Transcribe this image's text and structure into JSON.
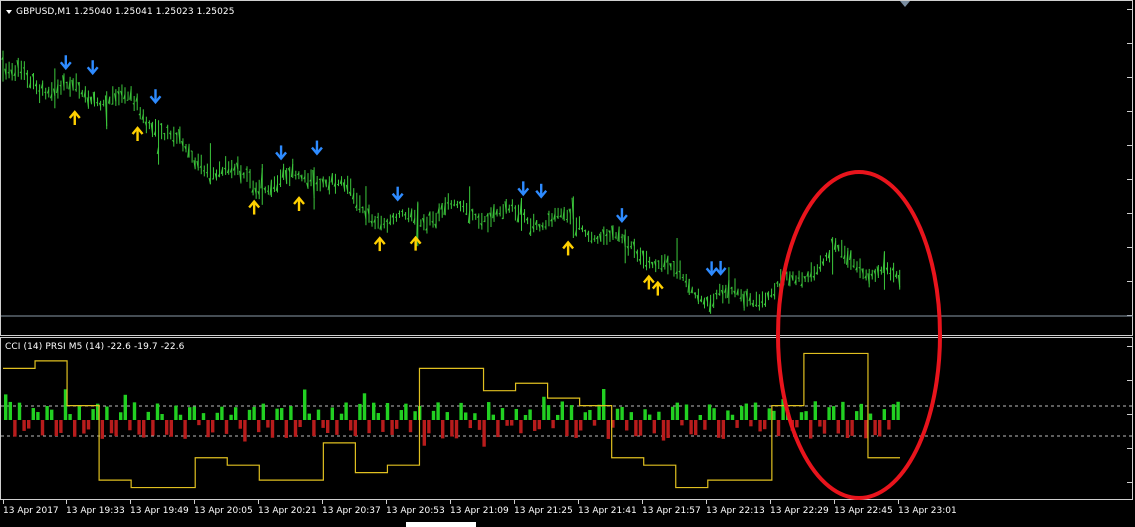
{
  "chart_window": {
    "price_pane_label": "GBPUSD,M1  1.25040 1.25041 1.25023 1.25025",
    "symbol": "GBPUSD",
    "timeframe": "M1",
    "ohlc": {
      "open": "1.25040",
      "high": "1.25041",
      "low": "1.25023",
      "close": "1.25025"
    },
    "indicator_label": "CCI (14) PRSI M5 (14) -22.6 -19.7 -22.6",
    "indicator_values": [
      "-22.6",
      "-19.7",
      "-22.6"
    ]
  },
  "colors": {
    "background": "#000000",
    "bars": "#3cc83c",
    "down_arrow": "#2e8bff",
    "up_arrow": "#ffd000",
    "annotation_ellipse": "#e8141c",
    "histogram_up": "#22d022",
    "histogram_down": "#b81c1c",
    "prsi_line": "#e0c020",
    "levels": "#bbbbbb"
  },
  "time_axis": {
    "labels": [
      "13 Apr 2017",
      "13 Apr 19:33",
      "13 Apr 19:49",
      "13 Apr 20:05",
      "13 Apr 20:21",
      "13 Apr 20:37",
      "13 Apr 20:53",
      "13 Apr 21:09",
      "13 Apr 21:25",
      "13 Apr 21:41",
      "13 Apr 21:57",
      "13 Apr 22:13",
      "13 Apr 22:29",
      "13 Apr 22:45",
      "13 Apr 23:01"
    ]
  },
  "chart_data": {
    "type": "line",
    "price_series": {
      "name": "GBPUSD,M1",
      "x": [
        "13 Apr 2017",
        "13 Apr 19:33",
        "13 Apr 19:49",
        "13 Apr 20:05",
        "13 Apr 20:21",
        "13 Apr 20:37",
        "13 Apr 20:53",
        "13 Apr 21:09",
        "13 Apr 21:25",
        "13 Apr 21:41",
        "13 Apr 21:57",
        "13 Apr 22:13",
        "13 Apr 22:29",
        "13 Apr 22:45",
        "13 Apr 23:01"
      ],
      "relative_level": [
        0.82,
        0.76,
        0.72,
        0.52,
        0.44,
        0.47,
        0.3,
        0.35,
        0.33,
        0.3,
        0.2,
        0.05,
        0.06,
        0.2,
        0.1
      ],
      "last_close": 1.25025
    },
    "arrows_down_index": [
      0.07,
      0.1,
      0.17,
      0.31,
      0.35,
      0.44,
      0.58,
      0.6,
      0.69,
      0.79,
      0.8
    ],
    "arrows_up_index": [
      0.08,
      0.15,
      0.28,
      0.33,
      0.42,
      0.46,
      0.63,
      0.72,
      0.73
    ],
    "indicator": {
      "cci_histogram_sign": [
        1,
        1,
        -1,
        1,
        -1,
        -1,
        1,
        1,
        -1,
        1,
        1,
        -1,
        -1,
        1,
        1,
        -1,
        1,
        -1,
        -1,
        1,
        1,
        -1,
        1,
        -1,
        -1,
        1,
        1,
        -1,
        1,
        -1,
        -1,
        1,
        -1,
        1,
        1,
        -1,
        -1,
        1,
        1,
        -1
      ],
      "prsi_levels_relative": [
        0.85,
        0.9,
        0.6,
        0.1,
        0.05,
        0.05,
        0.25,
        0.2,
        0.1,
        0.1,
        0.35,
        0.15,
        0.2,
        0.85,
        0.85,
        0.7,
        0.75,
        0.65,
        0.6,
        0.25,
        0.2,
        0.05,
        0.1,
        0.1,
        0.6,
        0.95,
        0.95,
        0.25
      ]
    }
  }
}
